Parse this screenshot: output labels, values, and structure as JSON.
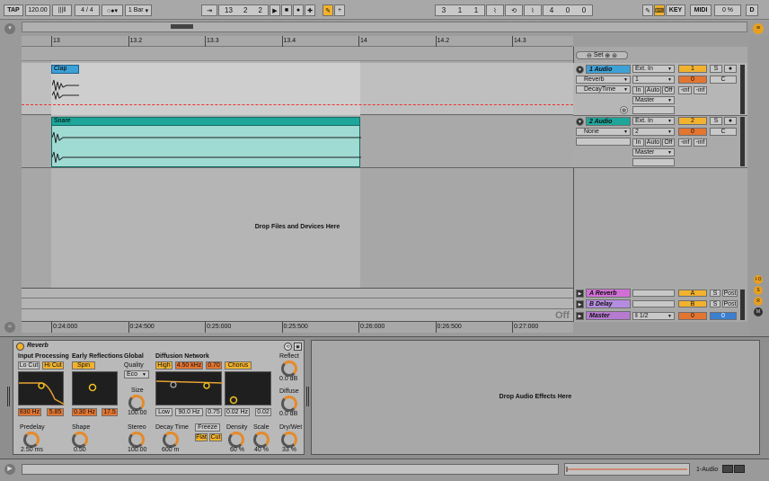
{
  "transport": {
    "tap": "TAP",
    "tempo": "120.00",
    "sig_num": "4",
    "sig_slash": "/",
    "sig_den": "4",
    "quant": "1 Bar",
    "pos1": "13",
    "pos2": "2",
    "pos3": "2",
    "loop1": "3",
    "loop2": "1",
    "loop3": "1",
    "len1": "4",
    "len2": "0",
    "len3": "0",
    "key": "KEY",
    "midi": "MIDI",
    "cpu": "0 %",
    "disk": "D"
  },
  "ruler": {
    "bars": [
      "13",
      "13.2",
      "13.3",
      "13.4",
      "14",
      "14.2",
      "14.3"
    ],
    "times": [
      "0:24:000",
      "0:24:500",
      "0:25:000",
      "0:25:500",
      "0:26:000",
      "0:26:500",
      "0:27:000"
    ]
  },
  "tracks": [
    {
      "clip": "Clap",
      "name": "1 Audio",
      "input": "Ext. In",
      "chan": "1",
      "device": "Reverb",
      "param": "DecayTime",
      "out": "Master",
      "num": "1",
      "solo": "S",
      "vol": "0",
      "pan": "C",
      "inf1": "-inf",
      "inf2": "-inf",
      "in": "In",
      "auto": "Auto",
      "off": "Off"
    },
    {
      "clip": "Snare",
      "name": "2 Audio",
      "input": "Ext. In",
      "chan": "2",
      "device": "None",
      "param": "",
      "out": "Master",
      "num": "2",
      "solo": "S",
      "vol": "0",
      "pan": "C",
      "inf1": "-inf",
      "inf2": "-inf",
      "in": "In",
      "auto": "Auto",
      "off": "Off"
    }
  ],
  "drop_files": "Drop Files and Devices Here",
  "returns": [
    {
      "name": "A Reverb",
      "letter": "A",
      "solo": "S",
      "post": "Post"
    },
    {
      "name": "B Delay",
      "letter": "B",
      "solo": "S",
      "post": "Post"
    }
  ],
  "master": {
    "name": "Master",
    "cue": "1/2",
    "vol": "0",
    "pan": "0",
    "off": "Off"
  },
  "set_label": "Set",
  "device": {
    "title": "Reverb",
    "input_processing": "Input Processing",
    "lo_cut": "Lo Cut",
    "hi_cut": "Hi Cut",
    "in_hz": "830 Hz",
    "in_q": "5.85",
    "early_reflections": "Early Reflections",
    "spin": "Spin",
    "er_hz": "0.30 Hz",
    "er_amt": "17.5",
    "global": "Global",
    "quality": "Quality",
    "quality_val": "Eco",
    "size": "Size",
    "size_val": "100.00",
    "diffusion": "Diffusion Network",
    "high": "High",
    "high_hz": "4.50 kHz",
    "high_val": "0.70",
    "low": "Low",
    "low_hz": "90.0 Hz",
    "low_val": "0.75",
    "chorus": "Chorus",
    "ch_hz": "0.02 Hz",
    "ch_val": "0.02",
    "reflect": "Reflect",
    "reflect_val": "0.0 dB",
    "diffuse": "Diffuse",
    "diffuse_val": "0.0 dB",
    "predelay": "Predelay",
    "predelay_val": "2.50 ms",
    "shape": "Shape",
    "shape_val": "0.50",
    "stereo": "Stereo",
    "stereo_val": "100.00",
    "decay": "Decay Time",
    "decay_val": "600 m",
    "freeze": "Freeze",
    "flat": "Flat",
    "cut": "Cut",
    "density": "Density",
    "density_val": "60 %",
    "scale": "Scale",
    "scale_val": "40 %",
    "drywet": "Dry/Wet",
    "drywet_val": "33 %"
  },
  "drop_effects": "Drop Audio Effects Here",
  "status": {
    "track": "1-Audio"
  }
}
